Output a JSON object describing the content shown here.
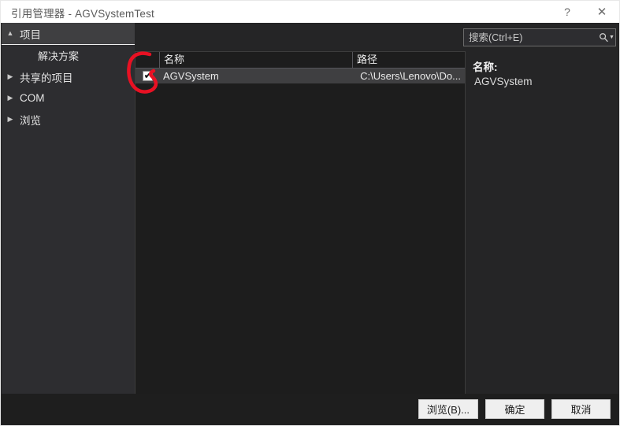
{
  "window": {
    "title": "引用管理器 - AGVSystemTest",
    "help_icon": "help-question-icon",
    "help_glyph": "?",
    "close_icon": "close-icon",
    "close_glyph": "✕"
  },
  "sidebar": {
    "items": [
      {
        "label": "项目",
        "expander": "▲",
        "level": 0,
        "expanded": true,
        "selected": false
      },
      {
        "label": "解决方案",
        "expander": "",
        "level": 1,
        "expanded": false,
        "selected": true
      },
      {
        "label": "共享的项目",
        "expander": "▶",
        "level": 0,
        "expanded": false,
        "selected": false
      },
      {
        "label": "COM",
        "expander": "▶",
        "level": 0,
        "expanded": false,
        "selected": false
      },
      {
        "label": "浏览",
        "expander": "▶",
        "level": 0,
        "expanded": false,
        "selected": false
      }
    ]
  },
  "search": {
    "placeholder": "搜索(Ctrl+E)",
    "value": "",
    "icon": "search-magnifier-icon",
    "dropdown_icon": "chevron-down-icon",
    "dropdown_glyph": "▼"
  },
  "list": {
    "columns": [
      "",
      "名称",
      "路径"
    ],
    "rows": [
      {
        "checked": true,
        "check_glyph": "✔",
        "name": "AGVSystem",
        "path": "C:\\Users\\Lenovo\\Do...",
        "selected": true
      }
    ]
  },
  "detail": {
    "label": "名称:",
    "value": "AGVSystem"
  },
  "buttons": {
    "browse": "浏览(B)...",
    "ok": "确定",
    "cancel": "取消"
  },
  "annotation": {
    "name": "red-circle-highlight",
    "color": "#e81123",
    "target": "row-checkbox"
  },
  "colors": {
    "titlebar_bg": "#ffffff",
    "sidebar_bg": "#2d2d30",
    "panel_bg": "#1d1d1d",
    "selection_bg": "#3f3f41",
    "text": "#e4e4e4",
    "button_bg": "#efefef",
    "annotation_red": "#e81123"
  }
}
